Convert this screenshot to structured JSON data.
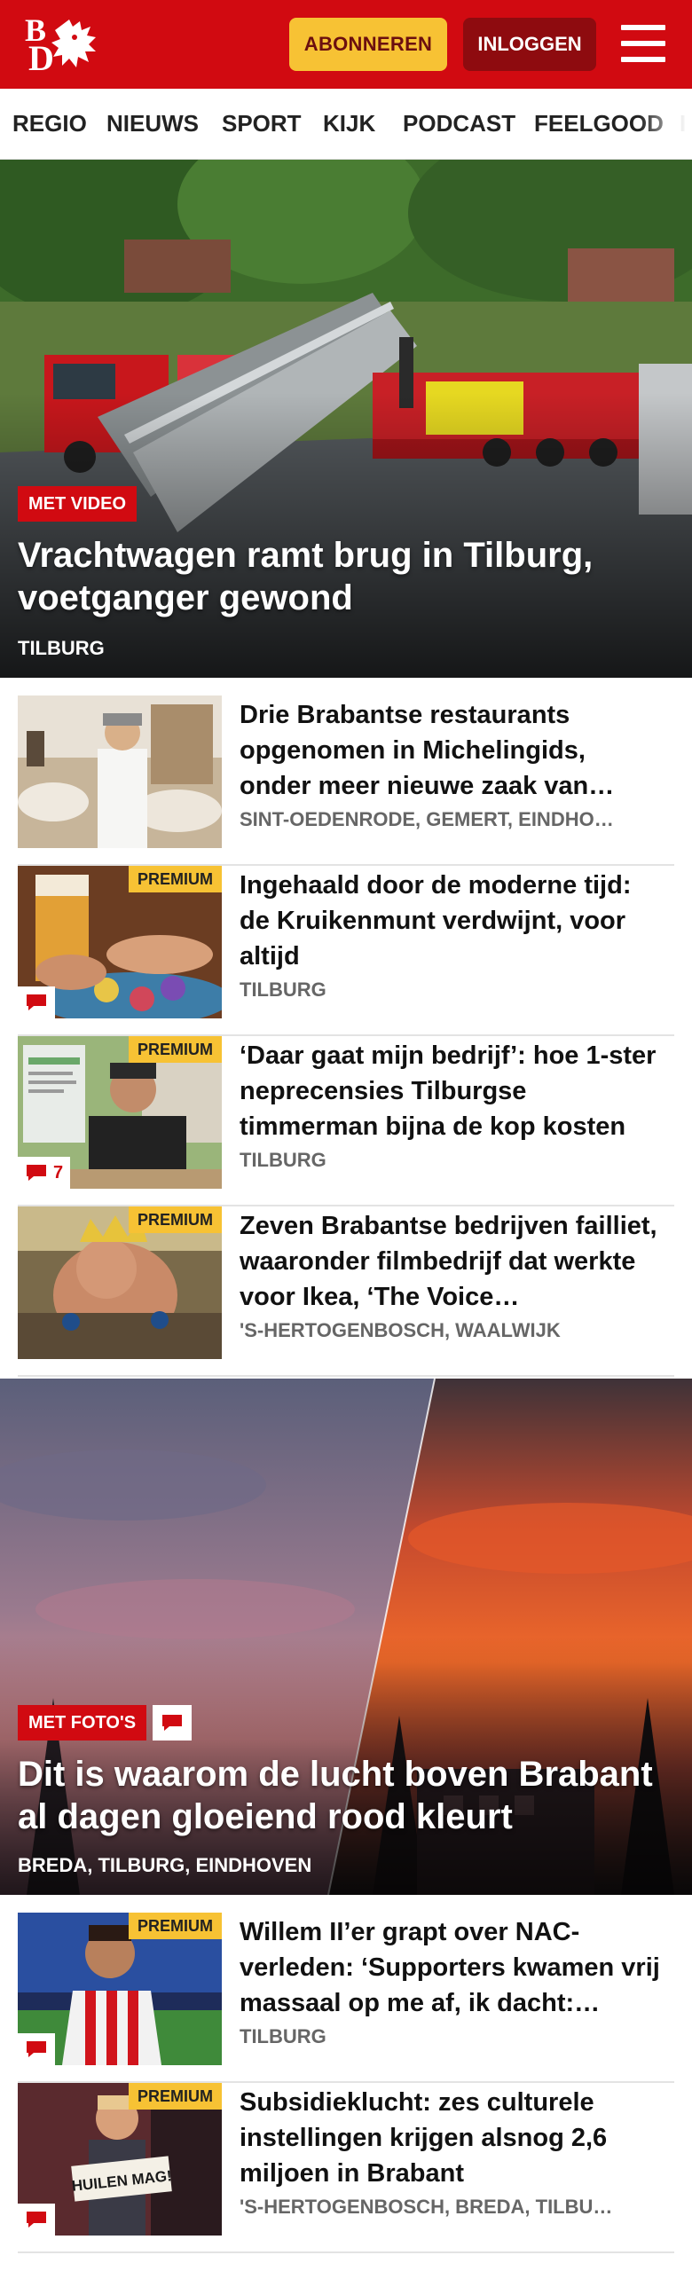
{
  "header": {
    "logo_letters": "BD",
    "subscribe_label": "ABONNEREN",
    "login_label": "INLOGGEN"
  },
  "nav": {
    "items": [
      "REGIO",
      "NIEUWS",
      "SPORT",
      "KIJK",
      "PODCAST",
      "FEELGOOD"
    ]
  },
  "hero1": {
    "tag": "MET VIDEO",
    "title": "Vrachtwagen ramt brug in Tilburg, voetganger gewond",
    "location": "TILBURG"
  },
  "articles1": [
    {
      "title": "Drie Brabantse restaurants opgenomen in Michelingids, onder meer nieuwe zaak van…",
      "location": "SINT-OEDENRODE, GEMERT, EINDHO…",
      "premium": false,
      "comments": null
    },
    {
      "title": "Ingehaald door de moderne tijd: de Kruikenmunt verdwijnt, voor altijd",
      "location": "TILBURG",
      "premium": true,
      "premium_label": "PREMIUM",
      "comments": ""
    },
    {
      "title": "‘Daar gaat mijn bedrijf’: hoe 1-ster neprecensies Tilburgse timmerman bijna de kop kosten",
      "location": "TILBURG",
      "premium": true,
      "premium_label": "PREMIUM",
      "comments": "7"
    },
    {
      "title": "Zeven Brabantse bedrijven failliet, waaronder filmbedrijf dat werkte voor Ikea, ‘The Voice…",
      "location": "'S-HERTOGENBOSCH, WAALWIJK",
      "premium": true,
      "premium_label": "PREMIUM",
      "comments": null
    }
  ],
  "hero2": {
    "tag": "MET FOTO'S",
    "title": "Dit is waarom de lucht boven Brabant al dagen gloeiend rood kleurt",
    "location": "BREDA, TILBURG, EINDHOVEN"
  },
  "articles2": [
    {
      "title": "Willem II’er grapt over NAC-verleden: ‘Supporters kwamen vrij massaal op me af, ik dacht:…",
      "location": "TILBURG",
      "premium": true,
      "premium_label": "PREMIUM",
      "comments": ""
    },
    {
      "title": "Subsidieklucht: zes culturele instellingen krijgen alsnog 2,6 miljoen in Brabant",
      "location": "'S-HERTOGENBOSCH, BREDA, TILBU…",
      "premium": true,
      "premium_label": "PREMIUM",
      "comments": "",
      "thumb_sign": "HUILEN MAG!"
    }
  ],
  "colors": {
    "brand_red": "#d10a11",
    "subscribe_yellow": "#f7c234",
    "login_dark_red": "#8e0b0f"
  }
}
